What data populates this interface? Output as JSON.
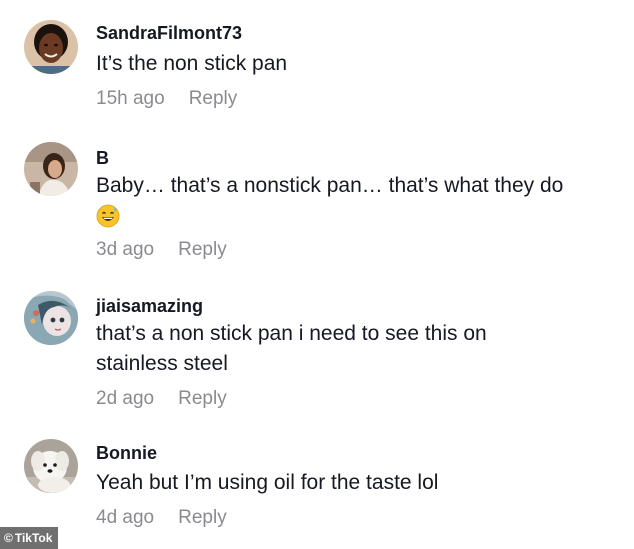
{
  "comments": [
    {
      "username": "SandraFilmont73",
      "text": "It’s the non stick pan",
      "time": "15h ago",
      "reply_label": "Reply"
    },
    {
      "username": "B",
      "text": "Baby… that’s a nonstick pan… that’s what they do",
      "emoji": "grinning-sweat-emoji",
      "time": "3d ago",
      "reply_label": "Reply"
    },
    {
      "username": "jiaisamazing",
      "text": "that’s a non stick pan i need to see this on stainless steel",
      "time": "2d ago",
      "reply_label": "Reply"
    },
    {
      "username": "Bonnie",
      "text": "Yeah but I’m using oil for the taste lol",
      "time": "4d ago",
      "reply_label": "Reply"
    }
  ],
  "watermark": {
    "symbol": "©",
    "label": "TikTok"
  }
}
